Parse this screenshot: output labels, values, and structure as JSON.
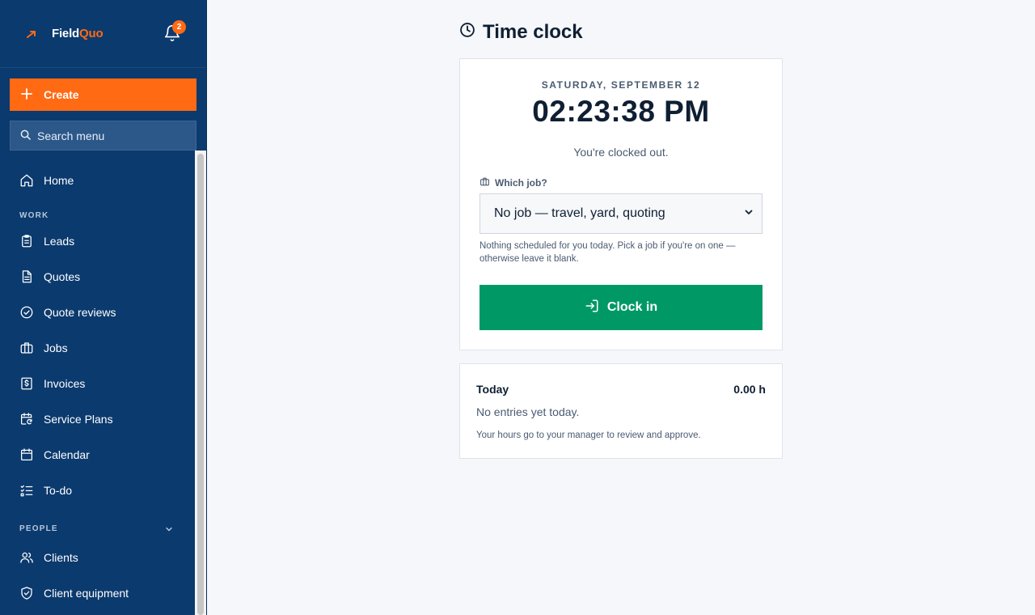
{
  "brand": {
    "name_part1": "Field",
    "name_part2": "Quo",
    "accent": "#ff6a13",
    "sidebar_bg": "#0b3a6e"
  },
  "notifications": {
    "count": "2",
    "icon": "bell-icon"
  },
  "sidebar": {
    "create_label": "Create",
    "search_placeholder": "Search menu",
    "home_label": "Home",
    "sections": {
      "work": "WORK",
      "people": "PEOPLE"
    },
    "work_items": [
      {
        "label": "Leads",
        "icon": "clipboard-icon"
      },
      {
        "label": "Quotes",
        "icon": "document-icon"
      },
      {
        "label": "Quote reviews",
        "icon": "check-circle-icon"
      },
      {
        "label": "Jobs",
        "icon": "briefcase-icon"
      },
      {
        "label": "Invoices",
        "icon": "invoice-dollar-icon"
      },
      {
        "label": "Service Plans",
        "icon": "calendar-refresh-icon"
      },
      {
        "label": "Calendar",
        "icon": "calendar-icon"
      },
      {
        "label": "To-do",
        "icon": "checklist-icon"
      }
    ],
    "people_items": [
      {
        "label": "Clients",
        "icon": "users-icon"
      },
      {
        "label": "Client equipment",
        "icon": "shield-check-icon"
      }
    ]
  },
  "main": {
    "title": "Time clock",
    "clock": {
      "date": "SATURDAY, SEPTEMBER 12",
      "time": "02:23:38 PM",
      "status": "You're clocked out.",
      "job_label": "Which job?",
      "job_selected": "No job — travel, yard, quoting",
      "hint": "Nothing scheduled for you today. Pick a job if you're on one — otherwise leave it blank.",
      "clock_in_label": "Clock in",
      "button_color": "#009966"
    },
    "today": {
      "label": "Today",
      "hours": "0.00 h",
      "empty": "No entries yet today.",
      "note": "Your hours go to your manager to review and approve."
    }
  }
}
